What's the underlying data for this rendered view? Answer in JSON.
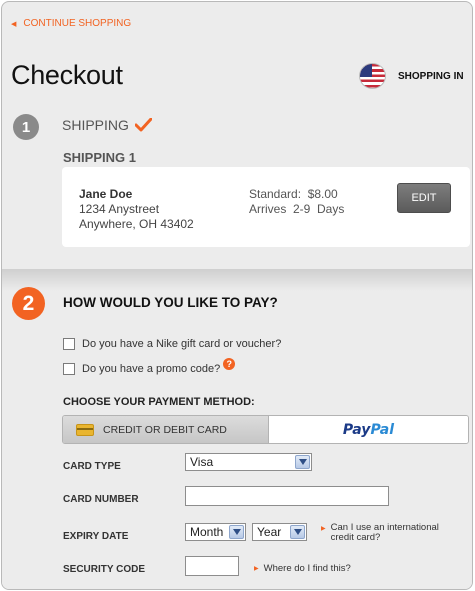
{
  "header": {
    "continue_label": "CONTINUE SHOPPING",
    "title": "Checkout",
    "shopping_in_label": "SHOPPING IN",
    "flag_icon": "us-flag-icon"
  },
  "shipping_step": {
    "number": "1",
    "label": "SHIPPING",
    "completed": true,
    "subheading": "SHIPPING 1",
    "address": {
      "name": "Jane Doe",
      "street": "1234 Anystreet",
      "city_state_zip": "Anywhere, OH 43402"
    },
    "method_line": "Standard:  $8.00",
    "arrival_line": "Arrives  2-9  Days",
    "edit_label": "EDIT"
  },
  "payment_step": {
    "number": "2",
    "heading": "HOW WOULD YOU LIKE TO PAY?",
    "gift_card_question": "Do you have a Nike gift card or voucher?",
    "promo_question": "Do you have a promo code?",
    "help_glyph": "?",
    "method_heading": "CHOOSE YOUR PAYMENT METHOD:",
    "tabs": {
      "card_label": "CREDIT OR DEBIT CARD",
      "paypal_part1": "Pay",
      "paypal_part2": "Pal"
    },
    "form": {
      "card_type_label": "CARD TYPE",
      "card_type_value": "Visa",
      "card_number_label": "CARD NUMBER",
      "card_number_value": "",
      "expiry_label": "EXPIRY DATE",
      "expiry_month": "Month",
      "expiry_year": "Year",
      "international_hint_line1": "Can I use an international",
      "international_hint_line2": "credit card?",
      "security_label": "SECURITY CODE",
      "security_value": "",
      "security_hint": "Where do I find this?"
    }
  },
  "colors": {
    "accent": "#f26322",
    "step_inactive": "#8a8a8a",
    "panel_bg": "#ececec"
  }
}
